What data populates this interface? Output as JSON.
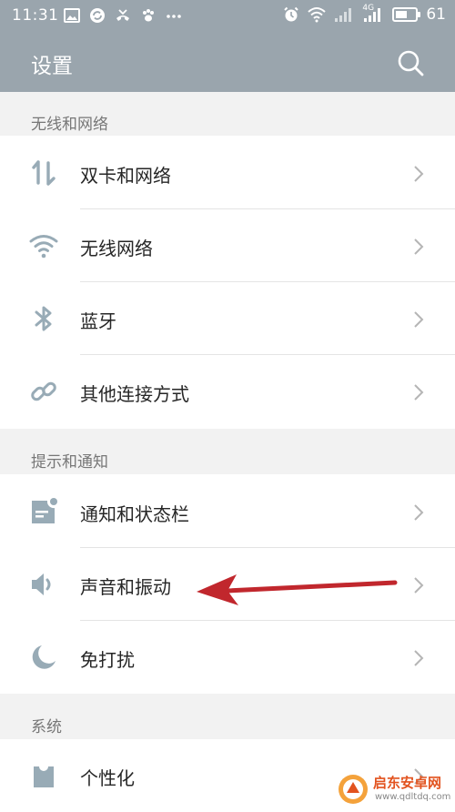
{
  "status_bar": {
    "time": "11:31",
    "battery_level": "61",
    "battery_fraction": 0.61,
    "network_label": "4G"
  },
  "header": {
    "title": "设置",
    "search_icon": "search-icon"
  },
  "sections": [
    {
      "title": "无线和网络",
      "items": [
        {
          "label": "双卡和网络",
          "icon": "dual-sim-arrows-icon"
        },
        {
          "label": "无线网络",
          "icon": "wifi-icon"
        },
        {
          "label": "蓝牙",
          "icon": "bluetooth-icon"
        },
        {
          "label": "其他连接方式",
          "icon": "link-icon"
        }
      ]
    },
    {
      "title": "提示和通知",
      "items": [
        {
          "label": "通知和状态栏",
          "icon": "notification-icon"
        },
        {
          "label": "声音和振动",
          "icon": "speaker-icon"
        },
        {
          "label": "免打扰",
          "icon": "moon-icon"
        }
      ]
    },
    {
      "title": "系统",
      "items": [
        {
          "label": "个性化",
          "icon": "personalization-icon"
        }
      ]
    }
  ],
  "annotation": {
    "arrow_color": "#c1272d",
    "target": "声音和振动"
  },
  "watermark": {
    "brand": "启东安卓网",
    "url": "www.qdltdq.com"
  },
  "colors": {
    "header_bg": "#9aa5ad",
    "section_bg": "#f2f2f2",
    "icon_color": "#98abb6",
    "chevron_color": "#b5b5b5"
  }
}
